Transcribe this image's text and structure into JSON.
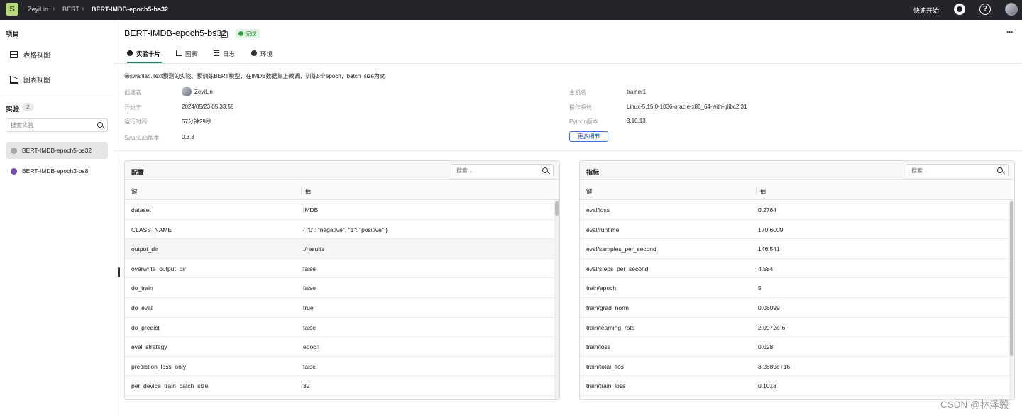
{
  "topbar": {
    "logo_glyph": "S",
    "breadcrumb": [
      "ZeyiLin",
      "BERT",
      "BERT-IMDB-epoch5-bs32"
    ],
    "quick_start": "快速开始"
  },
  "sidebar": {
    "title": "项目",
    "nav": [
      {
        "label": "表格视图",
        "icon": "table-icon"
      },
      {
        "label": "图表视图",
        "icon": "chart-icon"
      }
    ],
    "experiments_title": "实验",
    "experiments_count": "2",
    "search_placeholder": "搜索实验",
    "experiments": [
      {
        "name": "BERT-IMDB-epoch5-bs32",
        "color": "#a8a8a8",
        "active": true
      },
      {
        "name": "BERT-IMDB-epoch3-bs8",
        "color": "#7b4bb5",
        "active": false
      }
    ]
  },
  "experiment": {
    "title": "BERT-IMDB-epoch5-bs32",
    "status": "完成",
    "status_color": "#3aa14a",
    "tabs": [
      "实验卡片",
      "图表",
      "日志",
      "环境"
    ],
    "description": "带swanlab.Text预测的实验。预训练BERT模型，在IMDB数据集上微调，训练5个epoch，batch_size为5。",
    "meta_left": [
      {
        "label": "创建者",
        "value": "ZeyiLin"
      },
      {
        "label": "开始于",
        "value": "2024/05/23 05:33:58"
      },
      {
        "label": "运行时间",
        "value": "57分钟29秒"
      },
      {
        "label": "SwanLab版本",
        "value": "0.3.3"
      }
    ],
    "meta_right": [
      {
        "label": "主机名",
        "value": "trainer1"
      },
      {
        "label": "操作系统",
        "value": "Linux-5.15.0-1036-oracle-x86_64-with-glibc2.31"
      },
      {
        "label": "Python版本",
        "value": "3.10.13"
      }
    ],
    "more_details": "更多细节"
  },
  "config_panel": {
    "title": "配置",
    "search_placeholder": "搜索...",
    "col_key": "键",
    "col_value": "值",
    "rows": [
      {
        "key": "dataset",
        "value": "IMDB"
      },
      {
        "key": "CLASS_NAME",
        "value": "{ \"0\": \"negative\", \"1\": \"positive\" }"
      },
      {
        "key": "output_dir",
        "value": "./results"
      },
      {
        "key": "overwrite_output_dir",
        "value": "false"
      },
      {
        "key": "do_train",
        "value": "false"
      },
      {
        "key": "do_eval",
        "value": "true"
      },
      {
        "key": "do_predict",
        "value": "false"
      },
      {
        "key": "eval_strategy",
        "value": "epoch"
      },
      {
        "key": "prediction_loss_only",
        "value": "false"
      },
      {
        "key": "per_device_train_batch_size",
        "value": "32"
      }
    ]
  },
  "metrics_panel": {
    "title": "指标",
    "search_placeholder": "搜索...",
    "col_key": "键",
    "col_value": "值",
    "rows": [
      {
        "key": "eval/loss",
        "value": "0.2764"
      },
      {
        "key": "eval/runtime",
        "value": "170.6009"
      },
      {
        "key": "eval/samples_per_second",
        "value": "146.541"
      },
      {
        "key": "eval/steps_per_second",
        "value": "4.584"
      },
      {
        "key": "train/epoch",
        "value": "5"
      },
      {
        "key": "train/grad_norm",
        "value": "0.08099"
      },
      {
        "key": "train/learning_rate",
        "value": "2.0972e-6"
      },
      {
        "key": "train/loss",
        "value": "0.028"
      },
      {
        "key": "train/total_flos",
        "value": "3.2889e+16"
      },
      {
        "key": "train/train_loss",
        "value": "0.1018"
      }
    ]
  },
  "watermark": "CSDN @林泽毅"
}
